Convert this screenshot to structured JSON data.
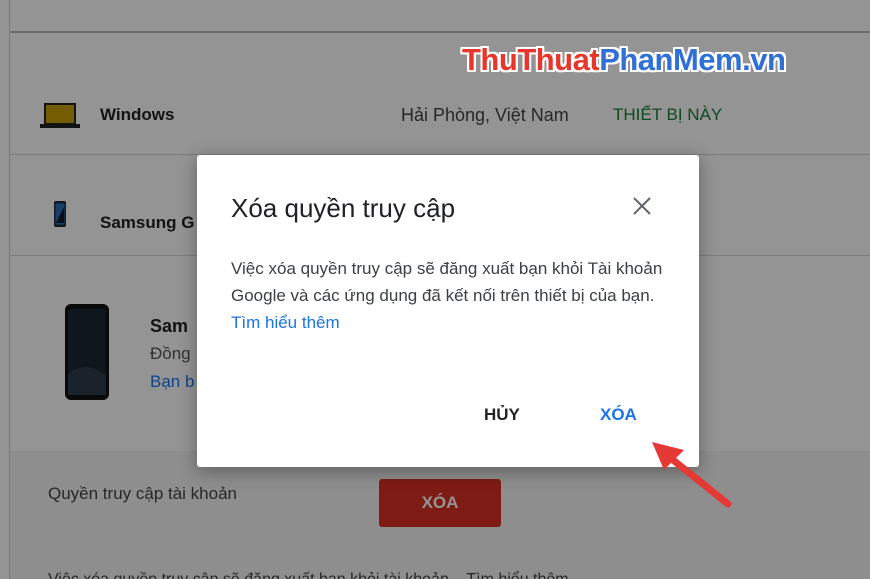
{
  "watermark": {
    "part1": "Thu",
    "part2": "Thuat",
    "part3": "PhanMem",
    "part4": ".vn"
  },
  "devices": {
    "windows": {
      "name": "Windows",
      "location": "Hải Phòng, Việt Nam",
      "badge": "THIẾT BỊ NÀY",
      "icon": "laptop-icon"
    },
    "samsung_row": {
      "name": "Samsung G",
      "icon": "phone-icon"
    },
    "samsung_card": {
      "title": "Sam",
      "subtitle": "Đồng",
      "link": "Bạn b",
      "icon": "phone-icon"
    }
  },
  "access": {
    "label": "Quyền truy cập tài khoản",
    "remove_button": "XÓA",
    "footer": "Việc xóa quyền truy cập sẽ đăng xuất bạn khỏi tài khoản... Tìm hiểu thêm"
  },
  "dialog": {
    "title": "Xóa quyền truy cập",
    "body": "Việc xóa quyền truy cập sẽ đăng xuất bạn khỏi Tài khoản Google và các ứng dụng đã kết nối trên thiết bị của bạn.",
    "learn_more": "Tìm hiểu thêm",
    "cancel": "HỦY",
    "confirm": "XÓA",
    "close_icon": "close-icon"
  },
  "colors": {
    "accent": "#1a73e8",
    "danger": "#d93025",
    "this_device": "#188038",
    "arrow": "#e53935"
  }
}
